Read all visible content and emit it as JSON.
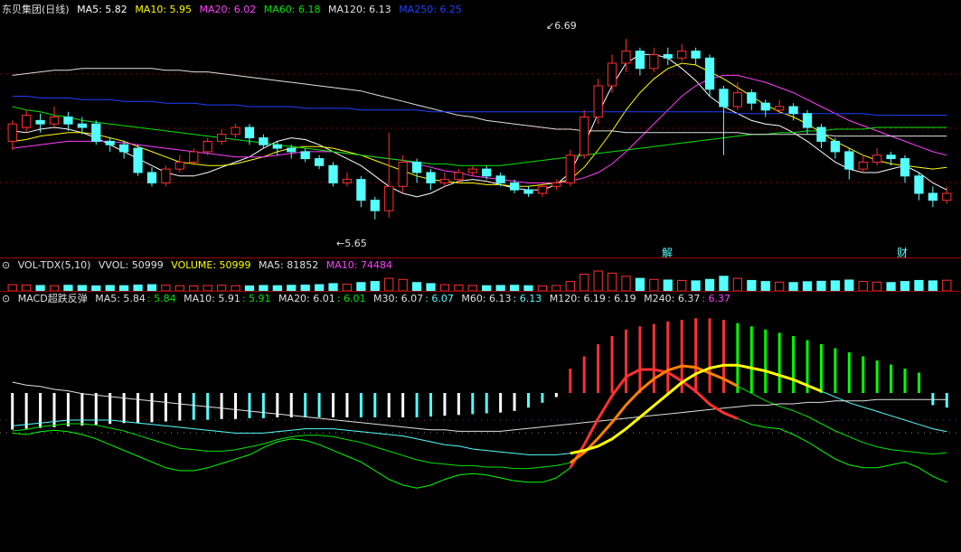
{
  "colors": {
    "bg": "#000000",
    "up": "#ff3030",
    "down": "#54ffff",
    "grid": "#8b0000",
    "ma5": "#ffffff",
    "ma10": "#ffff00",
    "ma20": "#ff40ff",
    "ma60": "#00e600",
    "ma120": "#e0e0e0",
    "ma250": "#2040ff"
  },
  "main": {
    "title": "东贝集团(日线)",
    "legend": [
      {
        "key": "MA5",
        "text": "MA5: 5.82",
        "color": "#ffffff"
      },
      {
        "key": "MA10",
        "text": "MA10: 5.95",
        "color": "#ffff00"
      },
      {
        "key": "MA20",
        "text": "MA20: 6.02",
        "color": "#ff40ff"
      },
      {
        "key": "MA60",
        "text": "MA60: 6.18",
        "color": "#00e600"
      },
      {
        "key": "MA120",
        "text": "MA120: 6.13",
        "color": "#e0e0e0"
      },
      {
        "key": "MA250",
        "text": "MA250: 6.25",
        "color": "#2040ff"
      }
    ],
    "high_label": "6.69",
    "low_label": "5.65",
    "marker_1": "解",
    "marker_2": "财"
  },
  "volume": {
    "title": "VOL-TDX(5,10)",
    "legend": [
      {
        "text": "VVOL: 50999",
        "color": "#e0e0e0"
      },
      {
        "text": "VOLUME: 50999",
        "color": "#ffff00"
      },
      {
        "text": "MA5: 81852",
        "color": "#e0e0e0"
      },
      {
        "text": "MA10: 74484",
        "color": "#ff40ff"
      }
    ]
  },
  "macd": {
    "title": "MACD超跌反弹",
    "legend": [
      {
        "text": "MA5: 5.84",
        "color": "#e0e0e0"
      },
      {
        "text": ": 5.84",
        "color": "#00e600"
      },
      {
        "text": "MA10: 5.91",
        "color": "#e0e0e0"
      },
      {
        "text": ": 5.91",
        "color": "#00e600"
      },
      {
        "text": "MA20: 6.01",
        "color": "#e0e0e0"
      },
      {
        "text": ": 6.01",
        "color": "#00e600"
      },
      {
        "text": "M30: 6.07",
        "color": "#e0e0e0"
      },
      {
        "text": ": 6.07",
        "color": "#54ffff"
      },
      {
        "text": "M60: 6.13",
        "color": "#e0e0e0"
      },
      {
        "text": ": 6.13",
        "color": "#54ffff"
      },
      {
        "text": "M120: 6.19",
        "color": "#e0e0e0"
      },
      {
        "text": ": 6.19",
        "color": "#e0e0e0"
      },
      {
        "text": "M240: 6.37",
        "color": "#e0e0e0"
      },
      {
        "text": ": 6.37",
        "color": "#ff40ff"
      }
    ]
  },
  "chart_data": [
    {
      "type": "candlestick",
      "title": "东贝集团(日线)",
      "ylim": [
        5.55,
        6.8
      ],
      "series": [
        {
          "name": "MA5",
          "values": [
            6.16,
            6.15,
            6.17,
            6.18,
            6.17,
            6.15,
            6.12,
            6.08,
            6.04,
            6.0,
            5.96,
            5.92,
            5.9,
            5.9,
            5.92,
            5.95,
            5.98,
            6.01,
            6.06,
            6.1,
            6.12,
            6.11,
            6.08,
            6.04,
            6.0,
            5.96,
            5.9,
            5.84,
            5.8,
            5.78,
            5.8,
            5.84,
            5.87,
            5.88,
            5.87,
            5.85,
            5.83,
            5.82,
            5.82,
            5.85,
            5.92,
            6.08,
            6.26,
            6.42,
            6.55,
            6.6,
            6.6,
            6.58,
            6.52,
            6.45,
            6.36,
            6.3,
            6.26,
            6.22,
            6.2,
            6.19,
            6.15,
            6.1,
            6.04,
            5.98,
            5.94,
            5.92,
            5.92,
            5.94,
            5.96,
            5.92,
            5.86,
            5.82
          ]
        },
        {
          "name": "MA10",
          "values": [
            6.1,
            6.11,
            6.13,
            6.14,
            6.15,
            6.15,
            6.14,
            6.12,
            6.1,
            6.07,
            6.04,
            6.01,
            5.98,
            5.97,
            5.96,
            5.96,
            5.97,
            5.99,
            6.01,
            6.04,
            6.06,
            6.07,
            6.07,
            6.06,
            6.04,
            6.02,
            5.99,
            5.96,
            5.93,
            5.9,
            5.88,
            5.87,
            5.86,
            5.86,
            5.85,
            5.85,
            5.84,
            5.84,
            5.85,
            5.86,
            5.88,
            5.95,
            6.05,
            6.16,
            6.28,
            6.38,
            6.46,
            6.52,
            6.55,
            6.54,
            6.5,
            6.46,
            6.41,
            6.36,
            6.31,
            6.27,
            6.24,
            6.2,
            6.15,
            6.1,
            6.06,
            6.02,
            5.99,
            5.97,
            5.96,
            5.95,
            5.94,
            5.95
          ]
        },
        {
          "name": "MA20",
          "values": [
            6.06,
            6.07,
            6.08,
            6.09,
            6.1,
            6.1,
            6.1,
            6.1,
            6.09,
            6.08,
            6.07,
            6.06,
            6.05,
            6.04,
            6.03,
            6.02,
            6.01,
            6.01,
            6.01,
            6.02,
            6.03,
            6.04,
            6.04,
            6.04,
            6.03,
            6.02,
            6.01,
            6.0,
            5.99,
            5.97,
            5.95,
            5.93,
            5.92,
            5.9,
            5.89,
            5.88,
            5.87,
            5.86,
            5.86,
            5.86,
            5.87,
            5.89,
            5.92,
            5.97,
            6.04,
            6.12,
            6.2,
            6.28,
            6.36,
            6.42,
            6.46,
            6.48,
            6.48,
            6.46,
            6.44,
            6.41,
            6.38,
            6.34,
            6.3,
            6.26,
            6.22,
            6.19,
            6.16,
            6.13,
            6.1,
            6.07,
            6.04,
            6.02
          ]
        },
        {
          "name": "MA60",
          "values": [
            6.3,
            6.28,
            6.27,
            6.25,
            6.24,
            6.22,
            6.21,
            6.2,
            6.19,
            6.18,
            6.17,
            6.16,
            6.15,
            6.14,
            6.13,
            6.12,
            6.11,
            6.1,
            6.09,
            6.08,
            6.07,
            6.06,
            6.05,
            6.04,
            6.03,
            6.02,
            6.01,
            6.0,
            5.99,
            5.98,
            5.97,
            5.97,
            5.96,
            5.96,
            5.96,
            5.96,
            5.97,
            5.98,
            5.99,
            6.0,
            6.01,
            6.02,
            6.03,
            6.04,
            6.05,
            6.06,
            6.07,
            6.08,
            6.09,
            6.1,
            6.11,
            6.12,
            6.13,
            6.14,
            6.14,
            6.15,
            6.15,
            6.16,
            6.16,
            6.17,
            6.17,
            6.17,
            6.18,
            6.18,
            6.18,
            6.18,
            6.18,
            6.18
          ]
        },
        {
          "name": "MA120",
          "values": [
            6.48,
            6.49,
            6.5,
            6.51,
            6.51,
            6.52,
            6.52,
            6.52,
            6.52,
            6.52,
            6.52,
            6.51,
            6.51,
            6.5,
            6.5,
            6.49,
            6.48,
            6.47,
            6.46,
            6.45,
            6.44,
            6.43,
            6.42,
            6.41,
            6.4,
            6.39,
            6.37,
            6.35,
            6.33,
            6.31,
            6.29,
            6.27,
            6.25,
            6.24,
            6.22,
            6.21,
            6.2,
            6.19,
            6.18,
            6.17,
            6.17,
            6.16,
            6.16,
            6.16,
            6.15,
            6.15,
            6.15,
            6.15,
            6.15,
            6.15,
            6.15,
            6.15,
            6.15,
            6.14,
            6.14,
            6.14,
            6.14,
            6.14,
            6.14,
            6.13,
            6.13,
            6.13,
            6.13,
            6.13,
            6.13,
            6.13,
            6.13,
            6.13
          ]
        },
        {
          "name": "MA250",
          "values": [
            6.36,
            6.36,
            6.35,
            6.35,
            6.35,
            6.34,
            6.34,
            6.34,
            6.33,
            6.33,
            6.33,
            6.32,
            6.32,
            6.32,
            6.31,
            6.31,
            6.31,
            6.3,
            6.3,
            6.3,
            6.3,
            6.29,
            6.29,
            6.29,
            6.29,
            6.28,
            6.28,
            6.28,
            6.28,
            6.28,
            6.27,
            6.27,
            6.27,
            6.27,
            6.27,
            6.27,
            6.27,
            6.27,
            6.27,
            6.27,
            6.27,
            6.27,
            6.27,
            6.27,
            6.27,
            6.27,
            6.27,
            6.27,
            6.27,
            6.27,
            6.27,
            6.27,
            6.26,
            6.26,
            6.26,
            6.26,
            6.26,
            6.26,
            6.26,
            6.26,
            6.26,
            6.26,
            6.25,
            6.25,
            6.25,
            6.25,
            6.25,
            6.25
          ]
        }
      ],
      "candles": [
        [
          6.1,
          6.2,
          6.05,
          6.22
        ],
        [
          6.18,
          6.25,
          6.15,
          6.28
        ],
        [
          6.22,
          6.2,
          6.15,
          6.26
        ],
        [
          6.2,
          6.24,
          6.18,
          6.3
        ],
        [
          6.24,
          6.2,
          6.16,
          6.27
        ],
        [
          6.2,
          6.18,
          6.14,
          6.24
        ],
        [
          6.2,
          6.1,
          6.08,
          6.22
        ],
        [
          6.1,
          6.08,
          6.04,
          6.12
        ],
        [
          6.08,
          6.04,
          6.0,
          6.1
        ],
        [
          6.06,
          5.92,
          5.9,
          6.08
        ],
        [
          5.92,
          5.86,
          5.84,
          5.95
        ],
        [
          5.86,
          5.94,
          5.84,
          5.96
        ],
        [
          5.94,
          5.98,
          5.92,
          6.02
        ],
        [
          5.98,
          6.04,
          5.96,
          6.06
        ],
        [
          6.04,
          6.1,
          6.02,
          6.12
        ],
        [
          6.1,
          6.14,
          6.08,
          6.17
        ],
        [
          6.14,
          6.18,
          6.12,
          6.2
        ],
        [
          6.18,
          6.12,
          6.08,
          6.2
        ],
        [
          6.12,
          6.08,
          6.06,
          6.14
        ],
        [
          6.08,
          6.06,
          6.02,
          6.1
        ],
        [
          6.06,
          6.04,
          6.0,
          6.08
        ],
        [
          6.04,
          6.0,
          5.98,
          6.06
        ],
        [
          6.0,
          5.96,
          5.94,
          6.02
        ],
        [
          5.96,
          5.86,
          5.84,
          5.98
        ],
        [
          5.86,
          5.88,
          5.84,
          5.92
        ],
        [
          5.88,
          5.76,
          5.72,
          5.9
        ],
        [
          5.76,
          5.7,
          5.65,
          5.78
        ],
        [
          5.7,
          5.84,
          5.66,
          6.15
        ],
        [
          5.84,
          5.98,
          5.8,
          6.02
        ],
        [
          5.98,
          5.92,
          5.86,
          6.0
        ],
        [
          5.92,
          5.86,
          5.82,
          5.94
        ],
        [
          5.86,
          5.88,
          5.84,
          5.92
        ],
        [
          5.88,
          5.92,
          5.86,
          5.94
        ],
        [
          5.92,
          5.94,
          5.9,
          5.96
        ],
        [
          5.94,
          5.9,
          5.88,
          5.96
        ],
        [
          5.9,
          5.86,
          5.84,
          5.92
        ],
        [
          5.86,
          5.82,
          5.8,
          5.88
        ],
        [
          5.82,
          5.8,
          5.78,
          5.84
        ],
        [
          5.8,
          5.84,
          5.78,
          5.86
        ],
        [
          5.84,
          5.86,
          5.82,
          5.88
        ],
        [
          5.86,
          6.02,
          5.84,
          6.05
        ],
        [
          6.02,
          6.24,
          6.0,
          6.28
        ],
        [
          6.24,
          6.42,
          6.2,
          6.46
        ],
        [
          6.42,
          6.55,
          6.38,
          6.6
        ],
        [
          6.55,
          6.62,
          6.5,
          6.69
        ],
        [
          6.62,
          6.52,
          6.48,
          6.64
        ],
        [
          6.52,
          6.6,
          6.5,
          6.64
        ],
        [
          6.6,
          6.58,
          6.54,
          6.64
        ],
        [
          6.58,
          6.62,
          6.56,
          6.66
        ],
        [
          6.62,
          6.58,
          6.54,
          6.64
        ],
        [
          6.58,
          6.4,
          6.36,
          6.6
        ],
        [
          6.4,
          6.3,
          6.02,
          6.42
        ],
        [
          6.3,
          6.38,
          6.28,
          6.44
        ],
        [
          6.38,
          6.32,
          6.28,
          6.4
        ],
        [
          6.32,
          6.28,
          6.24,
          6.34
        ],
        [
          6.28,
          6.3,
          6.26,
          6.34
        ],
        [
          6.3,
          6.26,
          6.22,
          6.32
        ],
        [
          6.26,
          6.18,
          6.14,
          6.28
        ],
        [
          6.18,
          6.1,
          6.06,
          6.2
        ],
        [
          6.1,
          6.04,
          6.0,
          6.12
        ],
        [
          6.04,
          5.94,
          5.88,
          6.06
        ],
        [
          5.94,
          5.98,
          5.92,
          6.02
        ],
        [
          5.98,
          6.02,
          5.96,
          6.06
        ],
        [
          6.02,
          6.0,
          5.96,
          6.04
        ],
        [
          6.0,
          5.9,
          5.86,
          6.02
        ],
        [
          5.9,
          5.8,
          5.76,
          5.92
        ],
        [
          5.8,
          5.76,
          5.72,
          5.84
        ],
        [
          5.76,
          5.8,
          5.74,
          5.84
        ]
      ]
    },
    {
      "type": "bar",
      "title": "VOL-TDX(5,10)",
      "values": [
        30,
        28,
        26,
        25,
        27,
        26,
        24,
        26,
        25,
        28,
        30,
        27,
        25,
        24,
        26,
        27,
        25,
        24,
        26,
        25,
        27,
        28,
        30,
        35,
        32,
        40,
        45,
        60,
        55,
        40,
        35,
        30,
        28,
        26,
        25,
        26,
        27,
        25,
        24,
        26,
        45,
        80,
        95,
        85,
        70,
        60,
        55,
        52,
        50,
        48,
        55,
        70,
        60,
        50,
        45,
        42,
        40,
        44,
        46,
        48,
        52,
        45,
        42,
        40,
        45,
        50,
        48,
        51
      ]
    },
    {
      "type": "bar",
      "title": "MACD超跌反弹",
      "values": [
        -0.45,
        -0.44,
        -0.43,
        -0.42,
        -0.41,
        -0.4,
        -0.39,
        -0.38,
        -0.37,
        -0.37,
        -0.36,
        -0.35,
        -0.34,
        -0.33,
        -0.33,
        -0.32,
        -0.32,
        -0.31,
        -0.31,
        -0.3,
        -0.3,
        -0.3,
        -0.3,
        -0.3,
        -0.3,
        -0.3,
        -0.3,
        -0.3,
        -0.3,
        -0.3,
        -0.29,
        -0.28,
        -0.27,
        -0.26,
        -0.25,
        -0.24,
        -0.22,
        -0.18,
        -0.12,
        -0.05,
        0.3,
        0.45,
        0.6,
        0.7,
        0.78,
        0.82,
        0.85,
        0.88,
        0.9,
        0.92,
        0.92,
        0.9,
        0.86,
        0.82,
        0.78,
        0.74,
        0.7,
        0.65,
        0.6,
        0.55,
        0.5,
        0.45,
        0.4,
        0.35,
        0.3,
        0.25,
        -0.15,
        -0.18
      ]
    }
  ]
}
